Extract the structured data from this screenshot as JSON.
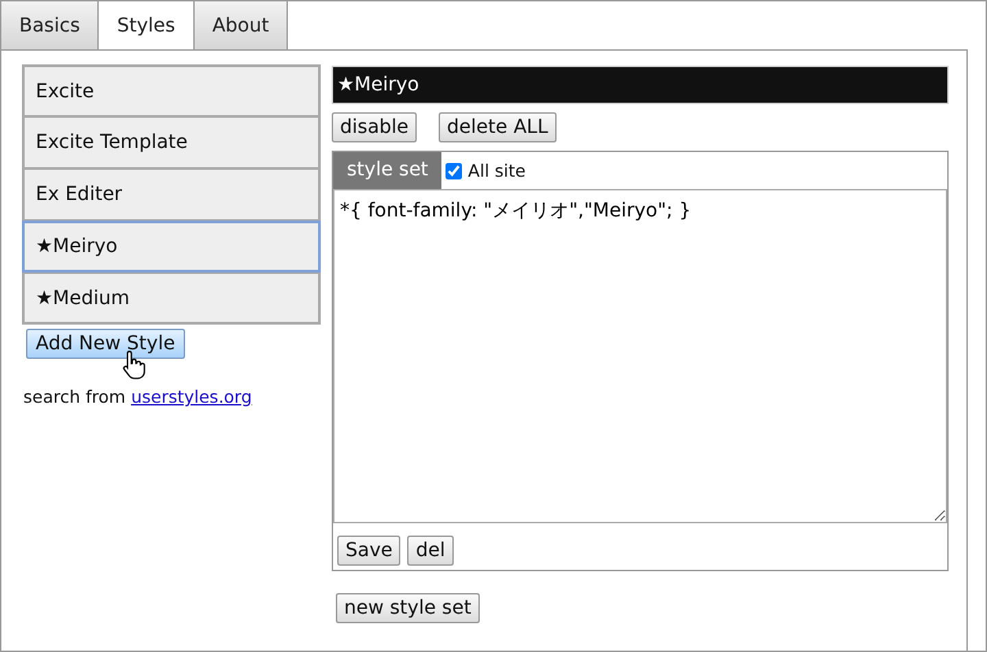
{
  "tabs": [
    {
      "label": "Basics",
      "selected": false
    },
    {
      "label": "Styles",
      "selected": true
    },
    {
      "label": "About",
      "selected": false
    }
  ],
  "styles": [
    {
      "label": "Excite",
      "selected": false
    },
    {
      "label": "Excite Template",
      "selected": false
    },
    {
      "label": "Ex Editer",
      "selected": false
    },
    {
      "label": "★Meiryo",
      "selected": true
    },
    {
      "label": "★Medium",
      "selected": false
    }
  ],
  "add_button": "Add New Style",
  "search": {
    "text": "search from ",
    "link": "userstyles.org"
  },
  "editor": {
    "title": "★Meiryo",
    "buttons": [
      "disable",
      "delete ALL"
    ],
    "style_sets": [
      {
        "tab": "style set",
        "all_site": {
          "label": "All site",
          "checked": true
        },
        "code": "*{ font-family: \"メイリオ\",\"Meiryo\"; }",
        "buttons": [
          "Save",
          "del"
        ]
      }
    ],
    "new_button": "new style set"
  }
}
